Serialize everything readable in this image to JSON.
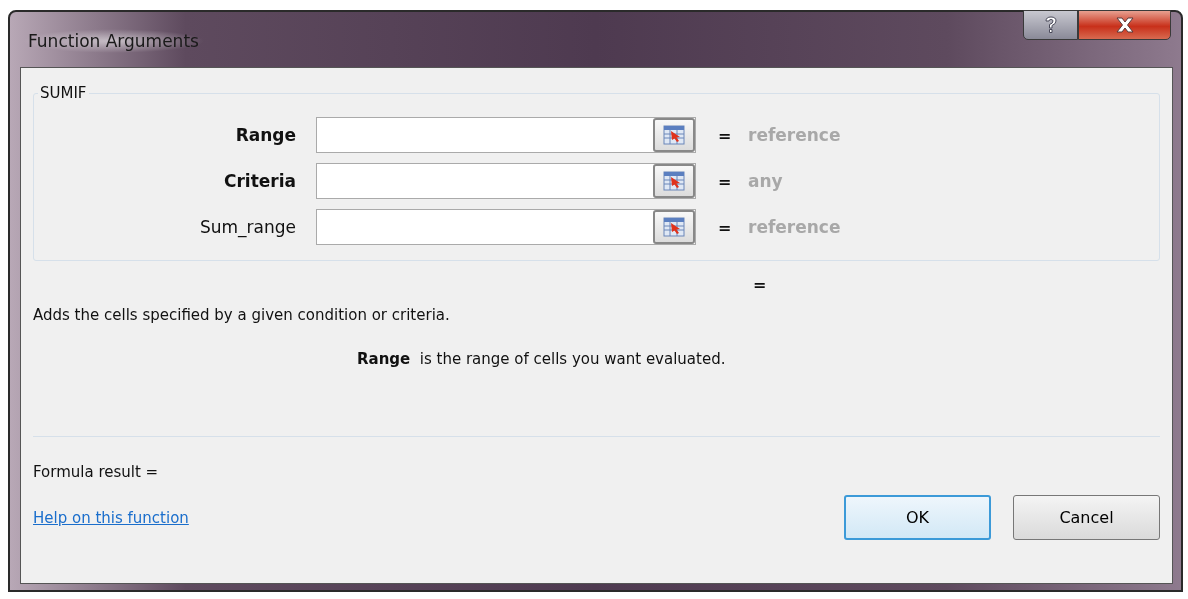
{
  "window": {
    "title": "Function Arguments"
  },
  "function_group": {
    "title": "SUMIF",
    "arguments": [
      {
        "label": "Range",
        "required": true,
        "equals": "=",
        "value_type": "reference"
      },
      {
        "label": "Criteria",
        "required": true,
        "equals": "=",
        "value_type": "any"
      },
      {
        "label": "Sum_range",
        "required": false,
        "equals": "=",
        "value_type": "reference"
      }
    ]
  },
  "result_equals": "=",
  "function_description": "Adds the cells specified by a given condition or criteria.",
  "argument_description": "**Range**  is the range of cells you want evaluated.",
  "formula_result": "Formula result =",
  "help_link": "Help on this function",
  "buttons": [
    {
      "label": "OK",
      "default": true
    },
    {
      "label": "Cancel",
      "default": false
    }
  ]
}
